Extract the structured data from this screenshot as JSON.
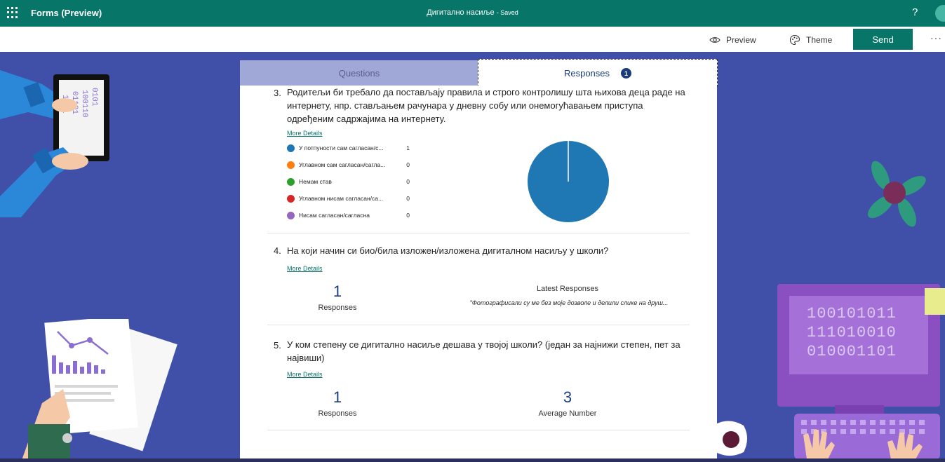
{
  "topbar": {
    "app_title": "Forms (Preview)",
    "doc_title": "Дигитално насиље",
    "saved_label": "- Saved",
    "help_label": "?"
  },
  "cmdbar": {
    "preview_label": "Preview",
    "theme_label": "Theme",
    "send_label": "Send",
    "more_label": "···"
  },
  "tabs": {
    "questions_label": "Questions",
    "responses_label": "Responses",
    "responses_count": "1"
  },
  "questions": [
    {
      "number": "3.",
      "text": "Родитељи би требало да постављају правила и строго контролишу шта њихова деца раде на интернету, нпр. стављањем рачунара у дневну собу или онемогућавањем приступа одређеним садржајима на интернету.",
      "more_details": "More Details",
      "options": [
        {
          "label": "У потпуности сам сагласан/с...",
          "count": "1",
          "color": "#1f77b4"
        },
        {
          "label": "Углавном сам сагласан/сагла...",
          "count": "0",
          "color": "#ff7f0e"
        },
        {
          "label": "Немам став",
          "count": "0",
          "color": "#2ca02c"
        },
        {
          "label": "Углавном нисам сагласан/са...",
          "count": "0",
          "color": "#d62728"
        },
        {
          "label": "Нисам сагласан/сагласна",
          "count": "0",
          "color": "#9467bd"
        }
      ]
    },
    {
      "number": "4.",
      "text": "На који начин си био/била изложен/изложена дигиталном насиљу у школи?",
      "more_details": "More Details",
      "responses_value": "1",
      "responses_label": "Responses",
      "latest_title": "Latest Responses",
      "latest_text": "\"Фотографисали су ме без моје дозволе и делили слике на друш..."
    },
    {
      "number": "5.",
      "text": "У ком степену се дигитално насиље дешава у твојој школи? (један за најнижи степен, пет за највиши)",
      "more_details": "More Details",
      "responses_value": "1",
      "responses_label": "Responses",
      "average_value": "3",
      "average_label": "Average Number"
    }
  ],
  "decorations": {
    "monitor_binary": [
      "100101011",
      "111010010",
      "010001101"
    ]
  },
  "chart_data": {
    "type": "pie",
    "categories": [
      "У потпуности сам сагласан/с...",
      "Углавном сам сагласан/сагла...",
      "Немам став",
      "Углавном нисам сагласан/са...",
      "Нисам сагласан/сагласна"
    ],
    "values": [
      1,
      0,
      0,
      0,
      0
    ],
    "colors": [
      "#1f77b4",
      "#ff7f0e",
      "#2ca02c",
      "#d62728",
      "#9467bd"
    ]
  }
}
